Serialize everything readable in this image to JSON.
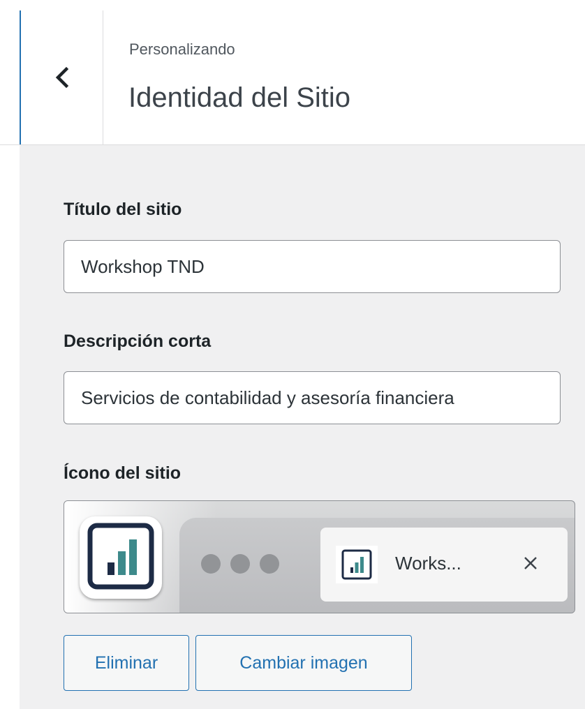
{
  "header": {
    "subtitle": "Personalizando",
    "title": "Identidad del Sitio",
    "back_icon": "chevron-left-icon"
  },
  "site_title": {
    "label": "Título del sitio",
    "value": "Workshop TND"
  },
  "tagline": {
    "label": "Descripción corta",
    "value": "Servicios de contabilidad y asesoría financiera"
  },
  "site_icon": {
    "label": "Ícono del sitio",
    "preview_tab_title": "Works...",
    "close_glyph": "✕",
    "icon_colors": {
      "frame": "#1d2b45",
      "bar_dark": "#1d2b45",
      "bar_teal": "#3d8a8b"
    },
    "remove_button": "Eliminar",
    "change_button": "Cambiar imagen"
  },
  "colors": {
    "accent": "#2271b1",
    "panel_bg": "#f0f0f1"
  }
}
